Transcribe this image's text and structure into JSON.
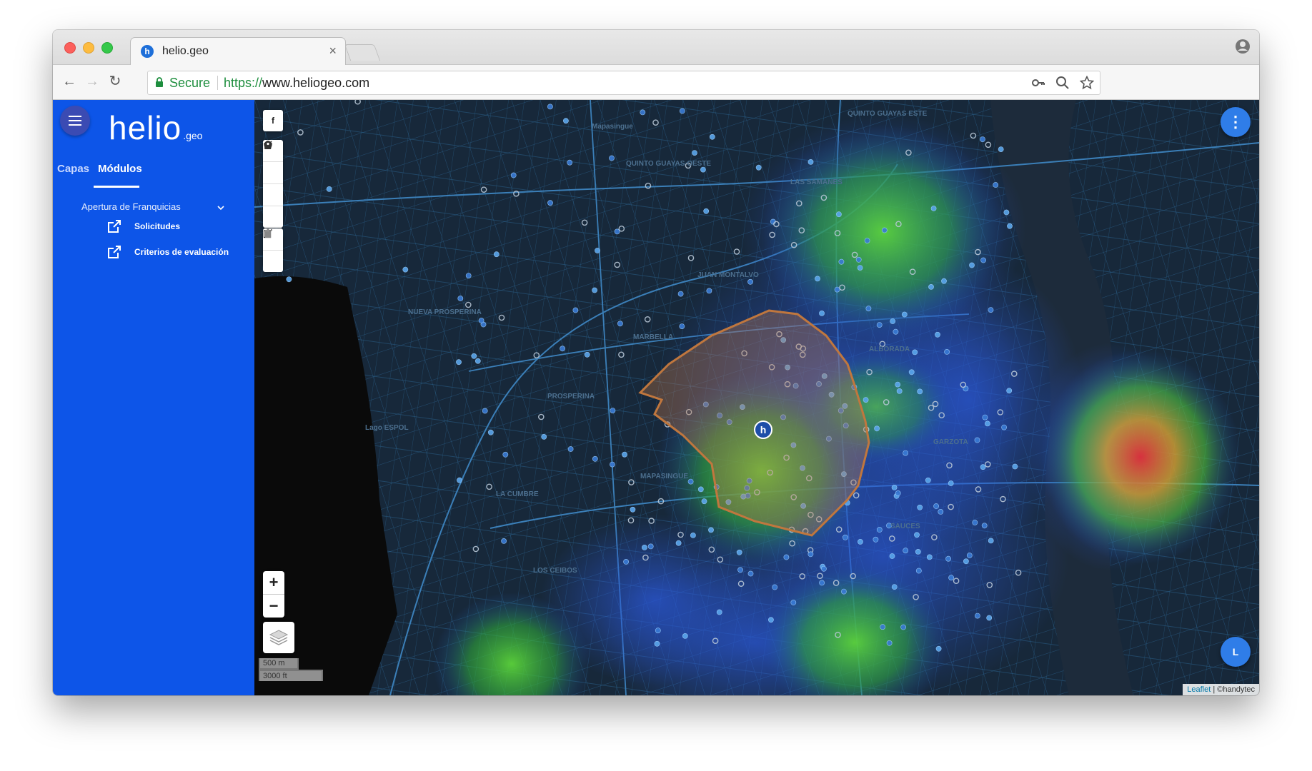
{
  "browser": {
    "tab_title": "helio.geo",
    "tab_favicon_letter": "h",
    "tab_close": "×",
    "secure_label": "Secure",
    "url_scheme": "https://",
    "url_host": "www.heliogeo.com"
  },
  "sidebar": {
    "logo_main": "helio",
    "logo_sub": ".geo",
    "tabs": [
      "Capas",
      "Módulos"
    ],
    "active_tab": "Módulos",
    "group_title": "Apertura de Franquicias",
    "items": [
      {
        "label": "Solicitudes",
        "icon": "external-link-icon"
      },
      {
        "label": "Criterios de evaluación",
        "icon": "external-link-icon"
      }
    ]
  },
  "map": {
    "draw_label": "f",
    "zoom_in": "+",
    "zoom_out": "−",
    "scale_metric": "500 m",
    "scale_imperial": "3000 ft",
    "fab_top": "⋮",
    "fab_bottom": "L",
    "marker_letter": "h",
    "attribution_link": "Leaflet",
    "attribution_text": "| ©handytec",
    "neighborhoods": [
      "QUINTO GUAYAS ESTE",
      "QUINTO GUAYAS OESTE",
      "Mapasingue",
      "LAS SAMANES",
      "JUAN MONTALVO",
      "NUEVA PROSPERINA",
      "MARBELLA",
      "PROSPERINA",
      "MAPASINGUE",
      "LA CUMBRE",
      "LOS CEIBOS",
      "ALBORADA",
      "GARZOTA",
      "SAUCES",
      "Lago ESPOL"
    ]
  },
  "colors": {
    "sidebar": "#0d55e8",
    "map_bg": "#17283a",
    "polygon": "#c0773e",
    "points": "#3a7bd5",
    "heat_green": "#3ec43a"
  }
}
